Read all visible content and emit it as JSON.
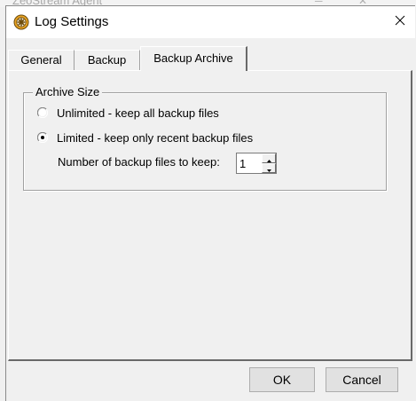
{
  "background_window": {
    "title": "ZeoStream Agent"
  },
  "dialog": {
    "title": "Log Settings",
    "app_icon": "gear-icon",
    "close_icon": "close-icon",
    "close_glyph": "✕"
  },
  "tabs": [
    {
      "label": "General",
      "selected": false
    },
    {
      "label": "Backup",
      "selected": false
    },
    {
      "label": "Backup Archive",
      "selected": true
    }
  ],
  "archive_size": {
    "group_label": "Archive Size",
    "options": [
      {
        "label": "Unlimited - keep all backup files",
        "selected": false
      },
      {
        "label": "Limited - keep only recent backup files",
        "selected": true
      }
    ],
    "count_label": "Number of backup files to keep:",
    "count_value": "1"
  },
  "buttons": {
    "ok": "OK",
    "cancel": "Cancel"
  },
  "colors": {
    "dialog_bg": "#f0f0f0",
    "titlebar_bg": "#ffffff",
    "icon_accent": "#e8a323"
  }
}
